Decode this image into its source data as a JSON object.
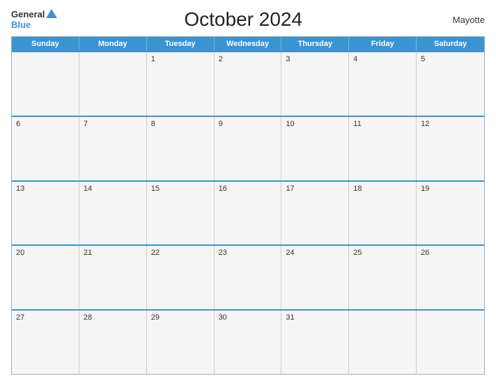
{
  "header": {
    "logo_general": "General",
    "logo_blue": "Blue",
    "title": "October 2024",
    "region": "Mayotte"
  },
  "days_of_week": [
    "Sunday",
    "Monday",
    "Tuesday",
    "Wednesday",
    "Thursday",
    "Friday",
    "Saturday"
  ],
  "weeks": [
    [
      null,
      null,
      1,
      2,
      3,
      4,
      5
    ],
    [
      6,
      7,
      8,
      9,
      10,
      11,
      12
    ],
    [
      13,
      14,
      15,
      16,
      17,
      18,
      19
    ],
    [
      20,
      21,
      22,
      23,
      24,
      25,
      26
    ],
    [
      27,
      28,
      29,
      30,
      31,
      null,
      null
    ]
  ]
}
